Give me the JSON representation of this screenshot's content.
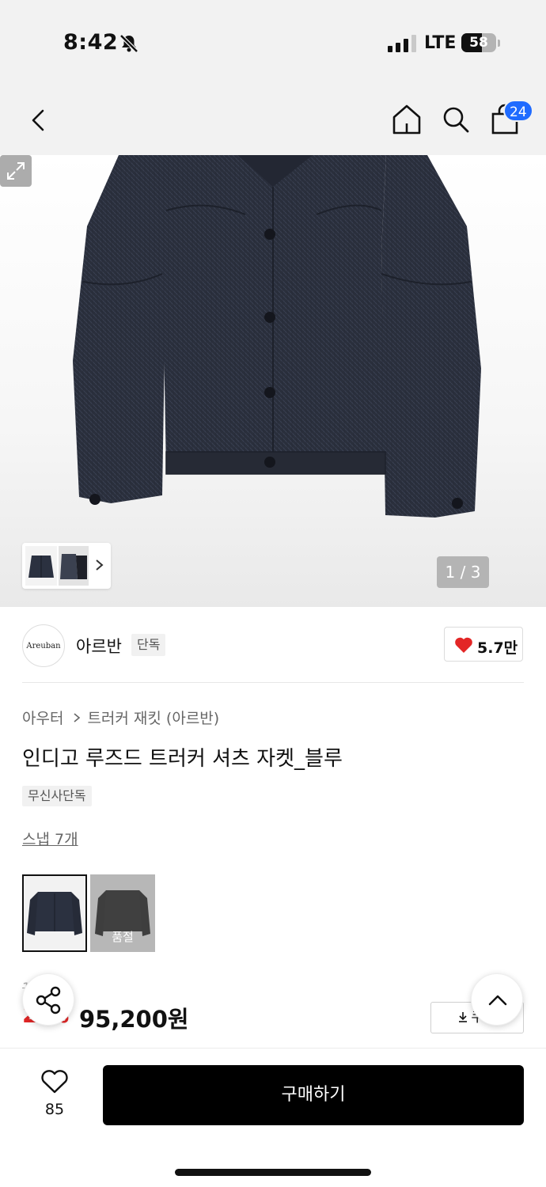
{
  "status_bar": {
    "time": "8:42",
    "network": "LTE",
    "battery": "58",
    "battery_level": 0.58
  },
  "header": {
    "cart_count": "24",
    "icons": [
      "chevron-left-icon",
      "home-icon",
      "search-icon",
      "shopping-bag-icon"
    ]
  },
  "gallery": {
    "pager": "1 / 3",
    "current_index": 1,
    "total": 3
  },
  "brand": {
    "logo_text": "Areuban",
    "name": "아르반",
    "exclusive_tag": "단독",
    "likes": "5.7만"
  },
  "product": {
    "breadcrumb": [
      "아우터",
      "트러커 재킷 (아르반)"
    ],
    "title": "인디고 루즈드 트러커 셔츠 자켓_블루",
    "store_tag": "무신사단독",
    "snap_link": "스냅 7개",
    "color_options": [
      {
        "name": "blue",
        "selected": true,
        "sold_out": false,
        "label": ""
      },
      {
        "name": "black",
        "selected": false,
        "sold_out": true,
        "label": "품절"
      }
    ]
  },
  "price": {
    "original": "1  0원",
    "discount": "2  %",
    "final": "95,200원",
    "coupon_label": "쿠폰"
  },
  "bottom_bar": {
    "wishlist_count": "85",
    "buy_label": "구매하기"
  },
  "colors": {
    "accent_blue": "#1f6bff",
    "discount_red": "#e32626",
    "heart_red": "#e32626",
    "buy_button": "#000000"
  }
}
